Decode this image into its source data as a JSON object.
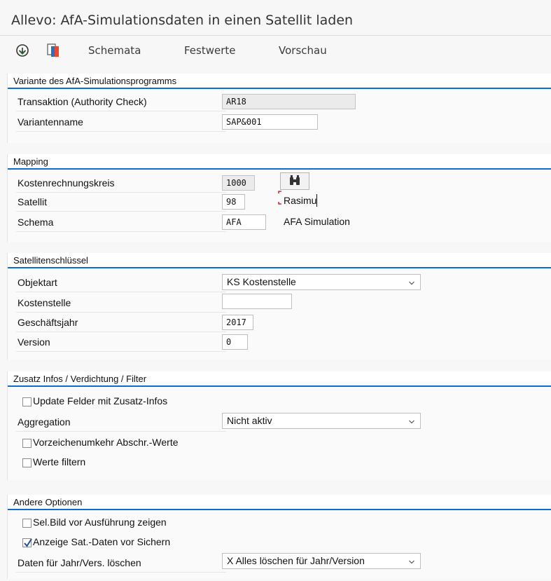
{
  "window": {
    "title": "Allevo: AfA-Simulationsdaten in einen Satellit laden"
  },
  "toolbar": {
    "icons": [
      "execute-icon",
      "copy-icon"
    ],
    "schemata_label": "Schemata",
    "festwerte_label": "Festwerte",
    "vorschau_label": "Vorschau"
  },
  "variant": {
    "title": "Variante des AfA-Simulationsprogramms",
    "transaction_label": "Transaktion (Authority Check)",
    "transaction_value": "AR18",
    "variant_name_label": "Variantenname",
    "variant_name_value": "SAP&001"
  },
  "mapping": {
    "title": "Mapping",
    "cost_area_label": "Kostenrechnungskreis",
    "cost_area_value": "1000",
    "satellite_label": "Satellit",
    "satellite_value": "98",
    "satellite_name": "Rasimu",
    "schema_label": "Schema",
    "schema_value": "AFA",
    "schema_desc": "AFA Simulation",
    "search_icon": "binoculars-icon"
  },
  "satkey": {
    "title": "Satellitenschlüssel",
    "object_type_label": "Objektart",
    "object_type_value": "KS Kostenstelle",
    "cost_center_label": "Kostenstelle",
    "cost_center_value": "",
    "fiscal_year_label": "Geschäftsjahr",
    "fiscal_year_value": "2017",
    "version_label": "Version",
    "version_value": "0"
  },
  "extra": {
    "title": "Zusatz Infos / Verdichtung / Filter",
    "update_fields_label": "Update Felder mit Zusatz-Infos",
    "update_fields_checked": false,
    "aggregation_label": "Aggregation",
    "aggregation_value": "Nicht aktiv",
    "sign_reversal_label": "Vorzeichenumkehr Abschr.-Werte",
    "sign_reversal_checked": false,
    "filter_values_label": "Werte filtern",
    "filter_values_checked": false
  },
  "other": {
    "title": "Andere Optionen",
    "show_selscreen_label": "Sel.Bild vor Ausführung zeigen",
    "show_selscreen_checked": false,
    "show_sat_data_label": "Anzeige Sat.-Daten vor Sichern",
    "show_sat_data_checked": true,
    "delete_label": "Daten für Jahr/Vers. löschen",
    "delete_value": "X Alles löschen für Jahr/Version"
  },
  "colors": {
    "accent": "#0a6ed1",
    "cursor": "#d0021b"
  }
}
